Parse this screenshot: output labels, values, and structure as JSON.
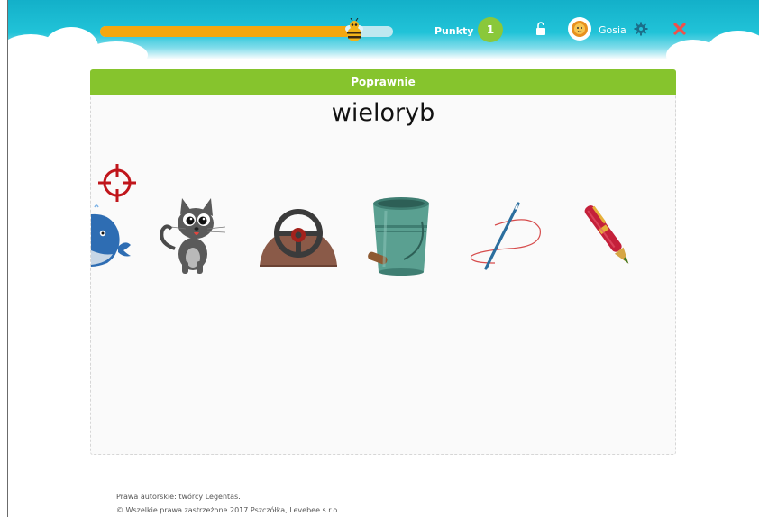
{
  "header": {
    "progress_percent": 86,
    "points_label": "Punkty",
    "points_value": "1",
    "username": "Gosia"
  },
  "card": {
    "status_label": "Poprawnie",
    "word": "wieloryb",
    "pictures": [
      "whale-picture",
      "cat-picture",
      "steering-wheel-picture",
      "bucket-picture",
      "needle-picture",
      "pen-picture"
    ]
  },
  "footer": {
    "line1": "Prawa autorskie: twórcy Legentas.",
    "line2": "© Wszelkie prawa zastrzeżone 2017 Pszczółka, Levebee s.r.o."
  },
  "colors": {
    "header_teal": "#13b0c9",
    "progress_orange": "#f5a70d",
    "points_green": "#8ac83a",
    "correct_green": "#86c42d",
    "target_red": "#c0151b"
  }
}
